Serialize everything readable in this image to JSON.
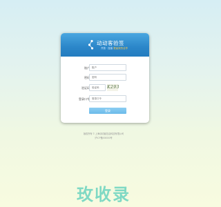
{
  "banner": {
    "title": "动动客验签",
    "subtitle_prefix": "开放 · 连接 ",
    "subtitle_highlight": "更高效的合作"
  },
  "form": {
    "account_label": "账户",
    "account_placeholder": "账户",
    "password_label": "密码",
    "password_placeholder": "密码",
    "captcha_label": "验证码",
    "captcha_placeholder": "验证码",
    "captcha_code": "K293",
    "login_label": "登录口令",
    "login_placeholder": "登录口令",
    "submit_label": "登录"
  },
  "footer": {
    "line1": "版权所有 © 上海动动客信息科技有限公司",
    "line2": "沪ICP备000000号"
  },
  "watermark": "玫收录"
}
